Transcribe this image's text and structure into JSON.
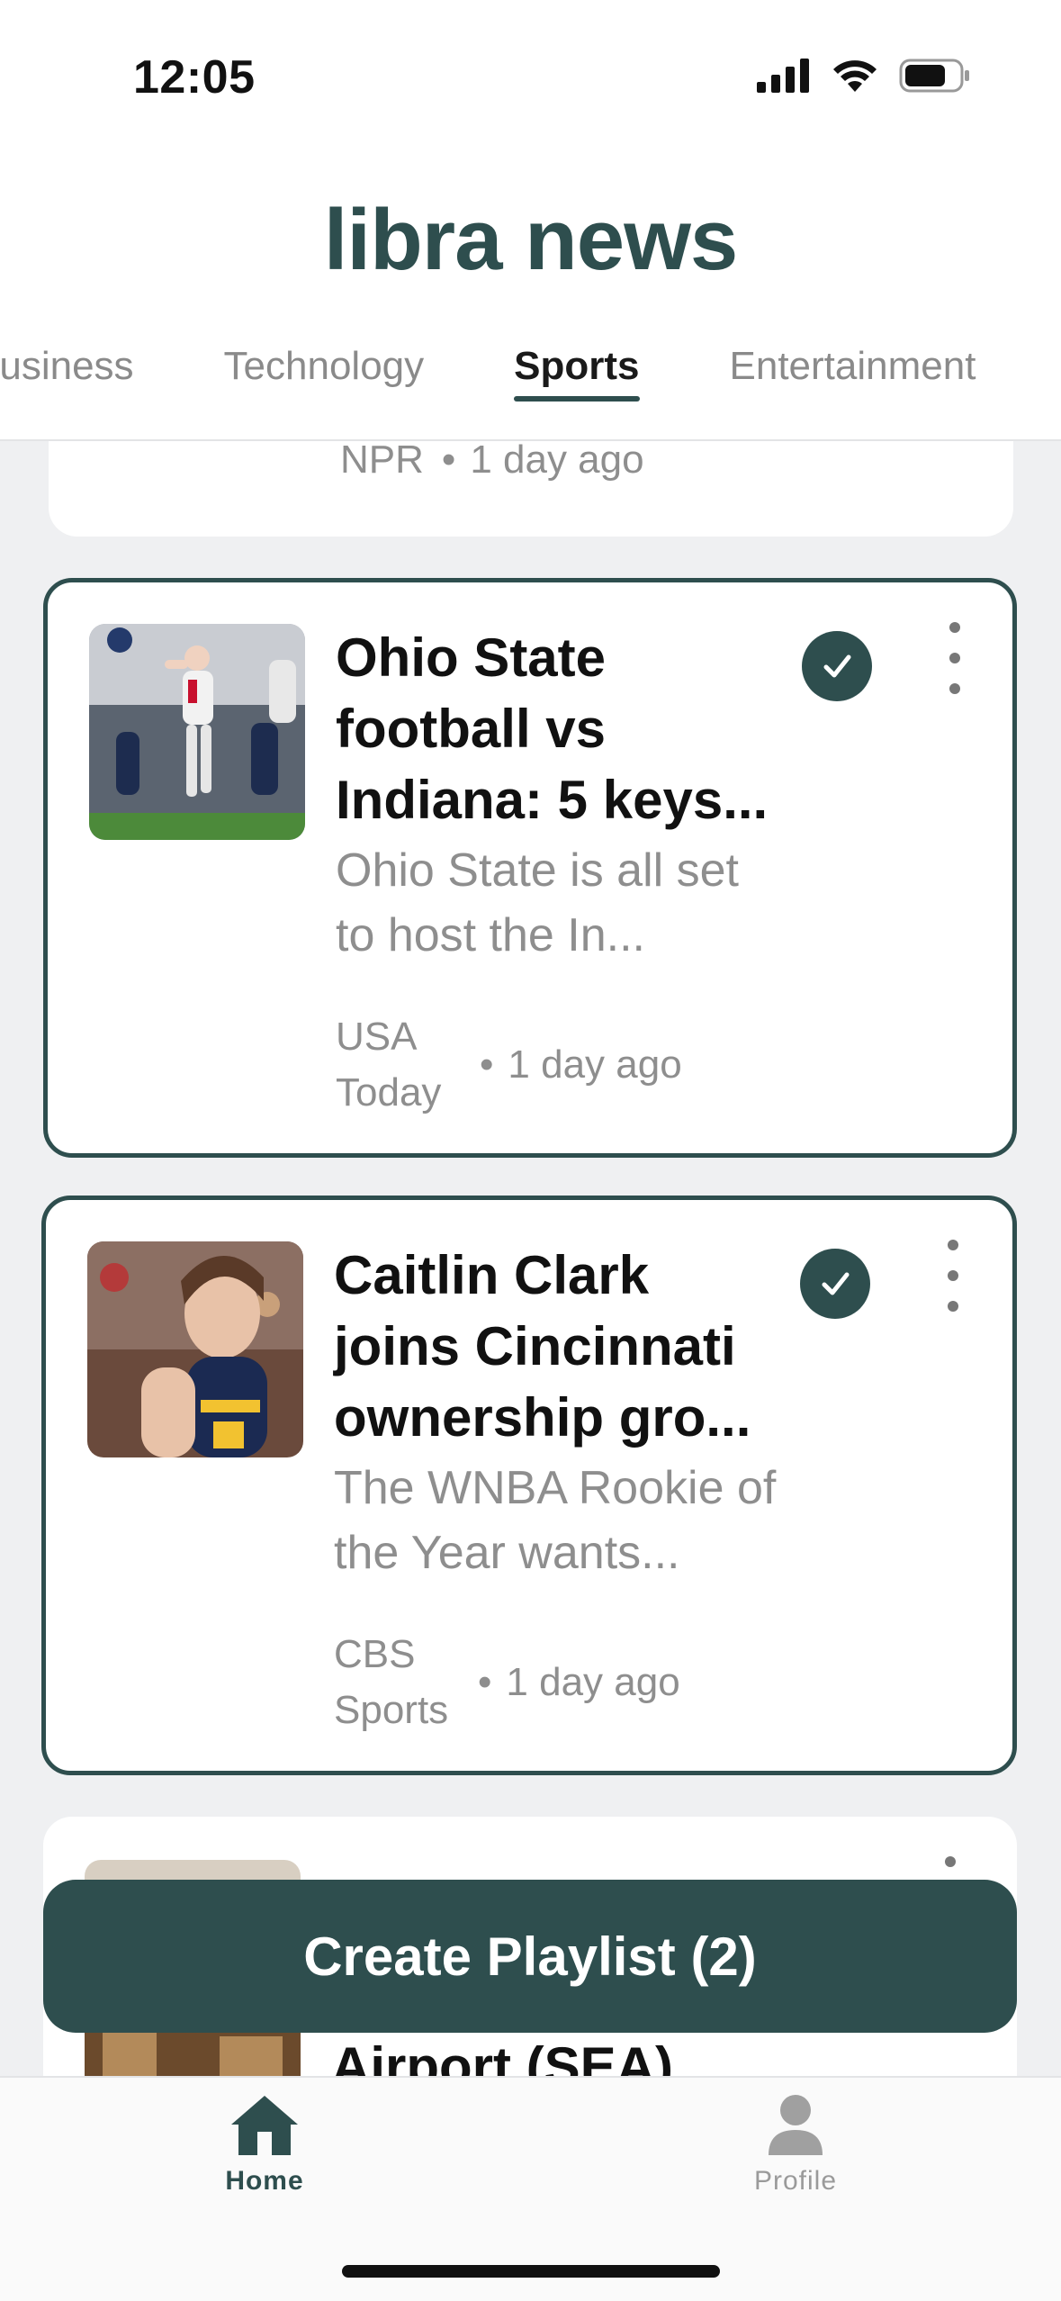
{
  "status_bar": {
    "time": "12:05"
  },
  "header": {
    "title": "libra news"
  },
  "tabs": [
    {
      "label": "Business",
      "active": false
    },
    {
      "label": "Technology",
      "active": false
    },
    {
      "label": "Sports",
      "active": true
    },
    {
      "label": "Entertainment",
      "active": false
    }
  ],
  "feed": {
    "partial_top": {
      "source": "NPR",
      "time": "1 day ago"
    },
    "articles": [
      {
        "headline": "Ohio State football vs Indiana: 5 keys...",
        "summary": "Ohio State is all set to host the In...",
        "source": "USA Today",
        "time": "1 day ago",
        "selected": true
      },
      {
        "headline": "Caitlin Clark joins Cincinnati ownership gro...",
        "summary": "The WNBA Rookie of the Year wants...",
        "source": "CBS Sports",
        "time": "1 day ago",
        "selected": true
      },
      {
        "headline": "Airport (SEA)",
        "selected": false
      }
    ]
  },
  "cta": {
    "label": "Create Playlist (2)"
  },
  "tabbar": {
    "home_label": "Home",
    "profile_label": "Profile"
  },
  "colors": {
    "accent": "#2e4e4e",
    "muted": "#8e8e8e",
    "background": "#eff0f2"
  }
}
